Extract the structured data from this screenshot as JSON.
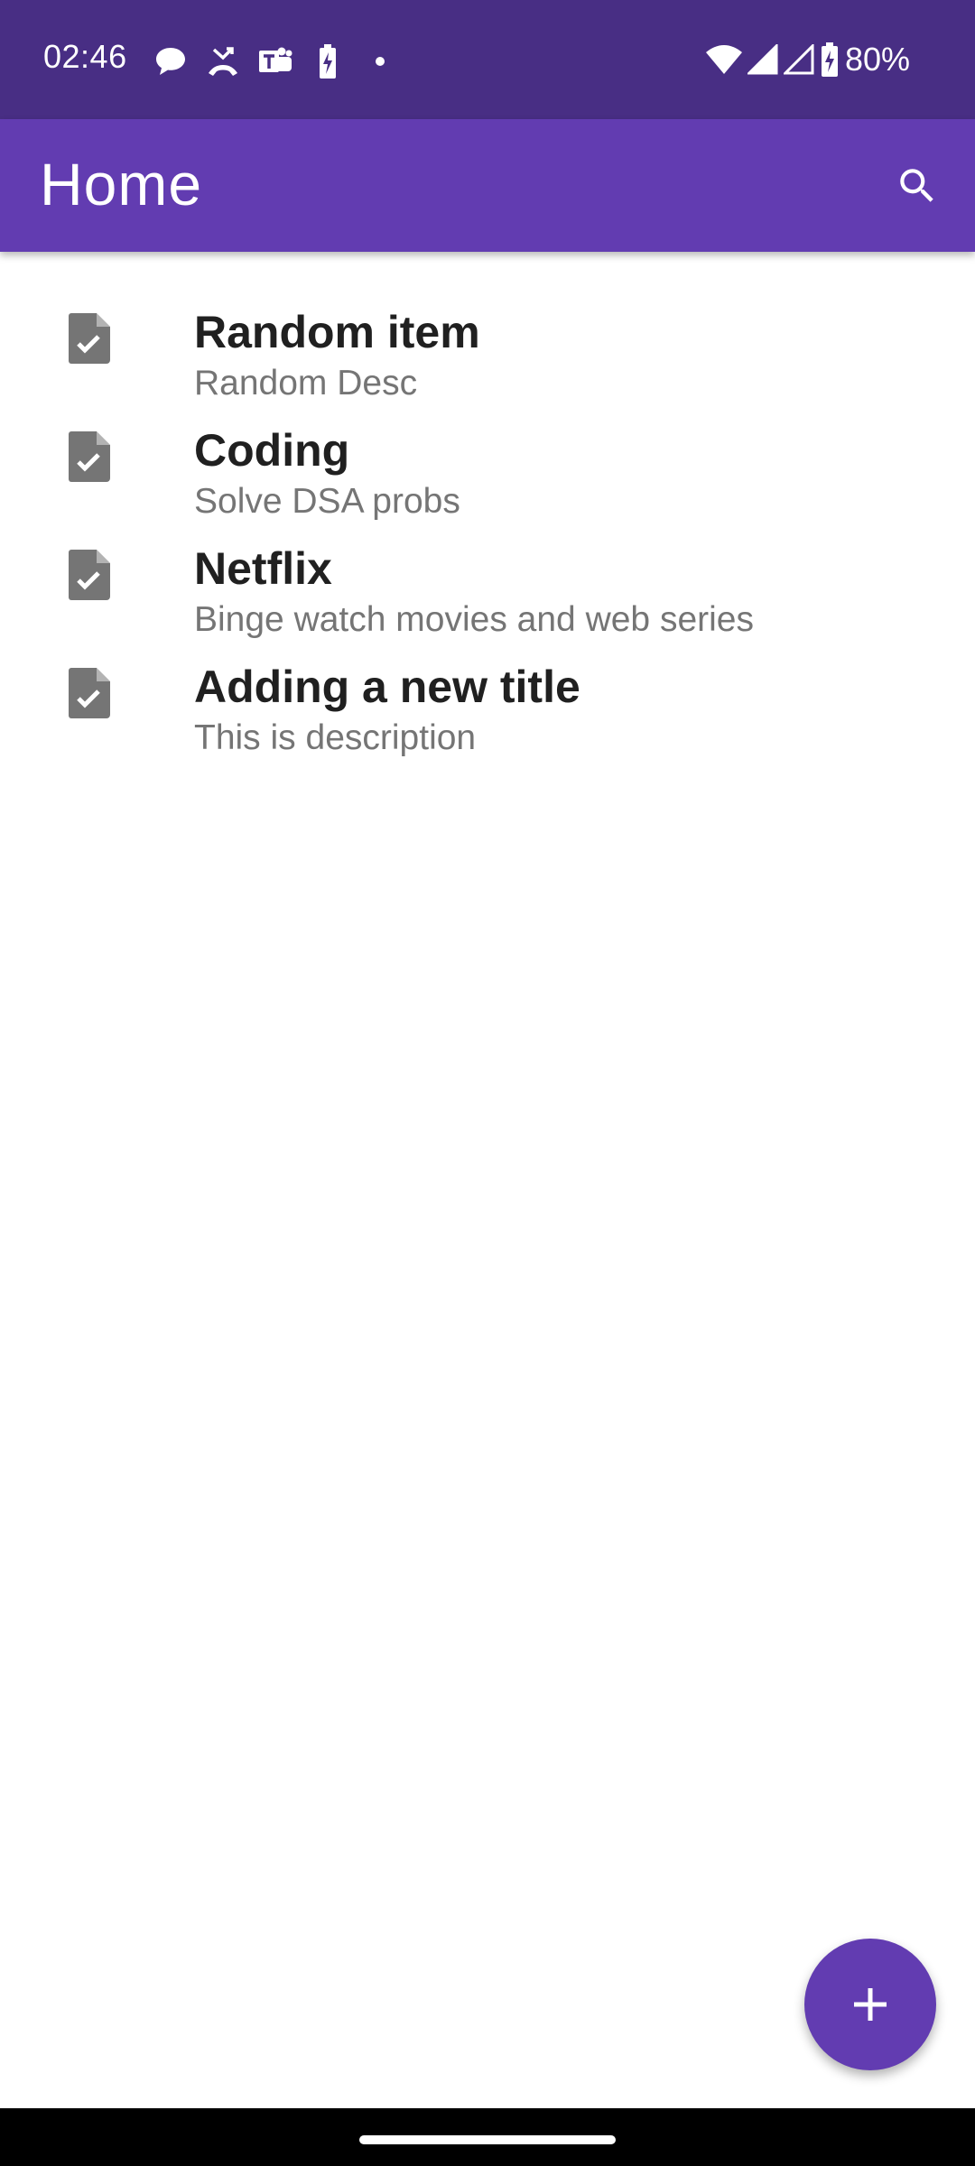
{
  "status_bar": {
    "time": "02:46",
    "battery": "80%",
    "notification_icons": [
      "chat-bubble-icon",
      "missed-call-icon",
      "teams-icon",
      "battery-charging-icon",
      "dot-icon"
    ],
    "system_icons": [
      "wifi-icon",
      "signal-icon",
      "signal-icon",
      "battery-icon"
    ]
  },
  "app_bar": {
    "title": "Home",
    "search_icon": "search-icon"
  },
  "items": [
    {
      "title": "Random item",
      "description": "Random Desc",
      "icon": "note-check-icon"
    },
    {
      "title": "Coding",
      "description": "Solve DSA probs",
      "icon": "note-check-icon"
    },
    {
      "title": "Netflix",
      "description": "Binge watch movies and web series",
      "icon": "note-check-icon"
    },
    {
      "title": "Adding a new title",
      "description": "This is description",
      "icon": "note-check-icon"
    }
  ],
  "fab": {
    "icon": "plus-icon"
  },
  "colors": {
    "status_bar": "#482e84",
    "app_bar": "#623cb1",
    "fab": "#623cb1",
    "icon_gray": "#757575",
    "title_text": "#202020",
    "desc_text": "#757575"
  }
}
